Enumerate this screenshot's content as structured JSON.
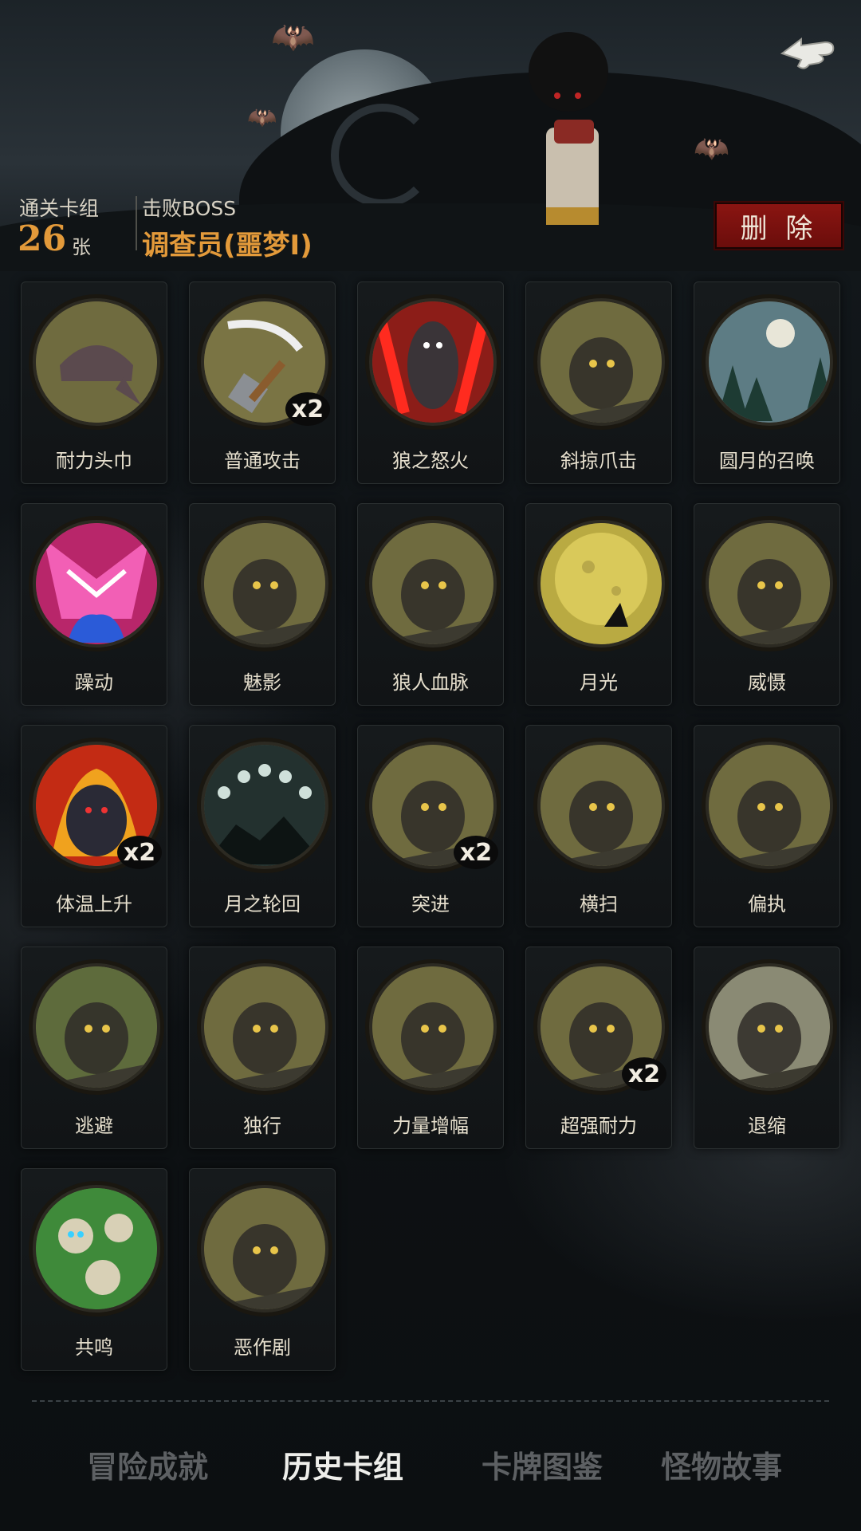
{
  "header": {
    "cleared_label": "通关卡组",
    "cleared_count": "26",
    "cleared_unit": "张",
    "boss_label": "击败BOSS",
    "boss_name": "调查员(噩梦I)",
    "delete_label": "删 除"
  },
  "colors": {
    "accent": "#e39a3a",
    "delete": "#8b1512"
  },
  "cards": [
    {
      "name": "耐力头巾",
      "icon": "bandana-icon",
      "mult": "",
      "bg": "#6f6b3f"
    },
    {
      "name": "普通攻击",
      "icon": "axe-icon",
      "mult": "x2",
      "bg": "#7a7444"
    },
    {
      "name": "狼之怒火",
      "icon": "werewolf-rage-icon",
      "mult": "",
      "bg": "#8c1d18"
    },
    {
      "name": "斜掠爪击",
      "icon": "claw-icon",
      "mult": "",
      "bg": "#6f6b3f"
    },
    {
      "name": "圆月的召唤",
      "icon": "full-moon-forest-icon",
      "mult": "",
      "bg": "#5d7c84"
    },
    {
      "name": "躁动",
      "icon": "frenzy-icon",
      "mult": "",
      "bg": "#b8266a"
    },
    {
      "name": "魅影",
      "icon": "phantom-icon",
      "mult": "",
      "bg": "#6f6b3f"
    },
    {
      "name": "狼人血脉",
      "icon": "hand-icon",
      "mult": "",
      "bg": "#6f6b3f"
    },
    {
      "name": "月光",
      "icon": "moonlight-icon",
      "mult": "",
      "bg": "#b9aa42"
    },
    {
      "name": "威慑",
      "icon": "bear-icon",
      "mult": "",
      "bg": "#6f6b3f"
    },
    {
      "name": "体温上升",
      "icon": "fire-wolf-icon",
      "mult": "x2",
      "bg": "#c32b14"
    },
    {
      "name": "月之轮回",
      "icon": "moon-phases-icon",
      "mult": "",
      "bg": "#23312f"
    },
    {
      "name": "突进",
      "icon": "lunge-icon",
      "mult": "x2",
      "bg": "#6f6b3f"
    },
    {
      "name": "横扫",
      "icon": "sweep-icon",
      "mult": "",
      "bg": "#6f6b3f"
    },
    {
      "name": "偏执",
      "icon": "wolf-bear-icon",
      "mult": "",
      "bg": "#6f6b3f"
    },
    {
      "name": "逃避",
      "icon": "escape-icon",
      "mult": "",
      "bg": "#5e6b3c"
    },
    {
      "name": "独行",
      "icon": "lone-walk-icon",
      "mult": "",
      "bg": "#6f6b3f"
    },
    {
      "name": "力量增幅",
      "icon": "log-lift-icon",
      "mult": "",
      "bg": "#6f6b3f"
    },
    {
      "name": "超强耐力",
      "icon": "wood-chop-icon",
      "mult": "x2",
      "bg": "#6f6b3f"
    },
    {
      "name": "退缩",
      "icon": "retreat-icon",
      "mult": "",
      "bg": "#8a8a74"
    },
    {
      "name": "共鸣",
      "icon": "skull-smoke-icon",
      "mult": "",
      "bg": "#3f8a3a"
    },
    {
      "name": "恶作剧",
      "icon": "prank-doll-icon",
      "mult": "",
      "bg": "#6f6b3f"
    }
  ],
  "tabs": [
    {
      "label": "冒险成就",
      "active": false
    },
    {
      "label": "历史卡组",
      "active": true
    },
    {
      "label": "卡牌图鉴",
      "active": false
    },
    {
      "label": "怪物故事",
      "active": false
    }
  ]
}
